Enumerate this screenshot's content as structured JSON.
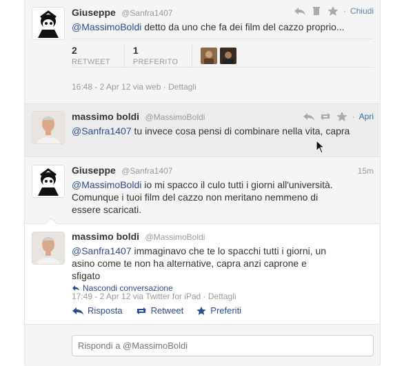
{
  "tweet1": {
    "name": "Giuseppe",
    "handle": "@Sanfra1407",
    "mention": "@MassimoBoldi",
    "text": " detto da uno che fa dei film del cazzo proprio...",
    "action_label": "Chiudi",
    "retweets_count": "2",
    "retweets_label": "RETWEET",
    "favorites_count": "1",
    "favorites_label": "PREFERITO",
    "meta": "16:48 - 2 Apr 12 via web · Dettagli"
  },
  "tweet2": {
    "name": "massimo boldi",
    "handle": "@MassimoBoldi",
    "mention": "@Sanfra1407",
    "text": " tu invece cosa pensi di combinare nella vita, capra",
    "action_label": "Apri"
  },
  "tweet3": {
    "name": "Giuseppe",
    "handle": "@Sanfra1407",
    "time": "15m",
    "mention": "@MassimoBoldi",
    "text": " io mi spacco il culo tutti i giorni all'università. Comunque i tuoi film del cazzo non meritano nemmeno di essere scaricati."
  },
  "tweet4": {
    "name": "massimo boldi",
    "handle": "@MassimoBoldi",
    "mention": "@Sanfra1407",
    "text": " immaginavo che te lo spacchi tutti i giorni, un asino come te non ha alternative, capra anzi caprone e sfigato",
    "hide_conversation": "Nascondi conversazione",
    "meta": "17:49 - 2 Apr 12 via Twitter for iPad · Dettagli",
    "reply_label": "Risposta",
    "retweet_label": "Retweet",
    "favorite_label": "Preferiti"
  },
  "reply_box": {
    "placeholder": "Rispondi a @MassimoBoldi"
  },
  "colors": {
    "link": "#2a4d8f",
    "muted": "#999999",
    "background": "#f5f5f5"
  }
}
